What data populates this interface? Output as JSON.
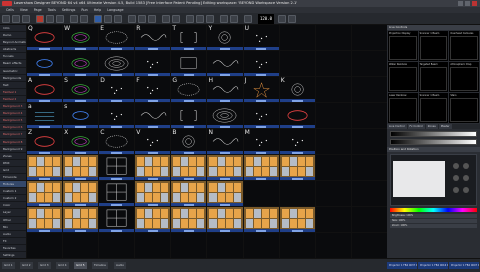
{
  "window": {
    "title": "Lasershow Designer BEYOND 64 v4 x64 Ultimate   Version 4.5, Build 1583   [Free Interface Patent Pending]   Editing workspace: 'BEYOND Workspace Version 2.1'"
  },
  "menu": [
    "Cells",
    "View",
    "Page",
    "Tools",
    "Settings",
    "Run",
    "Help",
    "Language"
  ],
  "toolbar": {
    "bpm_value": "120.0"
  },
  "left_panel": {
    "rows": [
      {
        "label": "Intro",
        "style": "normal"
      },
      {
        "label": "Demo",
        "style": "normal"
      },
      {
        "label": "Beyond Animations",
        "style": "normal"
      },
      {
        "label": "Abstracts",
        "style": "normal"
      },
      {
        "label": "Tunnels",
        "style": "normal"
      },
      {
        "label": "Beam effects",
        "style": "normal"
      },
      {
        "label": "Geometric",
        "style": "normal"
      },
      {
        "label": "Backgrounds",
        "style": "normal"
      },
      {
        "label": "Text",
        "style": "normal"
      },
      {
        "label": "Festival 1",
        "style": "red"
      },
      {
        "label": "Festival 2",
        "style": "red"
      },
      {
        "label": "Background 3",
        "style": "red"
      },
      {
        "label": "Background 4",
        "style": "red"
      },
      {
        "label": "Background 5",
        "style": "red"
      },
      {
        "label": "Background 6",
        "style": "red"
      },
      {
        "label": "Background 7",
        "style": "red"
      },
      {
        "label": "Background 8",
        "style": "red"
      },
      {
        "label": "Background 9",
        "style": "normal"
      },
      {
        "label": "Zones",
        "style": "normal"
      },
      {
        "label": "DMX",
        "style": "normal"
      },
      {
        "label": "Grid",
        "style": "normal"
      },
      {
        "label": "Timecode",
        "style": "normal"
      },
      {
        "label": "Fixtures",
        "style": "sel"
      },
      {
        "label": "Custom 1",
        "style": "normal"
      },
      {
        "label": "Custom 2",
        "style": "normal"
      },
      {
        "label": "Color",
        "style": "normal"
      },
      {
        "label": "Layer",
        "style": "normal"
      },
      {
        "label": "Other",
        "style": "normal"
      },
      {
        "label": "Mix",
        "style": "normal"
      },
      {
        "label": "Audio",
        "style": "normal"
      },
      {
        "label": "FX",
        "style": "normal"
      },
      {
        "label": "Favorites",
        "style": "normal"
      },
      {
        "label": "Settings",
        "style": "normal"
      }
    ]
  },
  "grid": {
    "cells": [
      {
        "key": "Q",
        "shape": "ellipse-red"
      },
      {
        "key": "W",
        "shape": "ellipse-multi"
      },
      {
        "key": "E",
        "shape": "dots-ring"
      },
      {
        "key": "R",
        "shape": "wave"
      },
      {
        "key": "T",
        "shape": "brackets"
      },
      {
        "key": "Y",
        "shape": "flower"
      },
      {
        "key": "U",
        "shape": "dots"
      },
      {
        "key": "",
        "shape": "none"
      },
      {
        "key": "",
        "shape": "none"
      },
      {
        "key": "",
        "shape": "none"
      },
      {
        "key": "",
        "shape": "ellipse-blue"
      },
      {
        "key": "",
        "shape": "ellipse-multi"
      },
      {
        "key": "",
        "shape": "rings"
      },
      {
        "key": "",
        "shape": "dots"
      },
      {
        "key": "",
        "shape": "rect"
      },
      {
        "key": "",
        "shape": "wave"
      },
      {
        "key": "",
        "shape": "dots"
      },
      {
        "key": "",
        "shape": "none"
      },
      {
        "key": "",
        "shape": "none"
      },
      {
        "key": "",
        "shape": "none"
      },
      {
        "key": "A",
        "shape": "ellipse-red"
      },
      {
        "key": "S",
        "shape": "ellipse-multi"
      },
      {
        "key": "D",
        "shape": "dots"
      },
      {
        "key": "F",
        "shape": "dots"
      },
      {
        "key": "G",
        "shape": "dots-ring"
      },
      {
        "key": "H",
        "shape": "wave"
      },
      {
        "key": "J",
        "shape": "star"
      },
      {
        "key": "K",
        "shape": "flower"
      },
      {
        "key": "",
        "shape": "none"
      },
      {
        "key": "",
        "shape": "none"
      },
      {
        "key": "a",
        "shape": "lines"
      },
      {
        "key": "s",
        "shape": "ellipse-blue"
      },
      {
        "key": "",
        "shape": "dots"
      },
      {
        "key": "",
        "shape": "wave"
      },
      {
        "key": "",
        "shape": "brackets"
      },
      {
        "key": "",
        "shape": "rings"
      },
      {
        "key": "",
        "shape": "dots"
      },
      {
        "key": "",
        "shape": "ellipse-red"
      },
      {
        "key": "",
        "shape": "none"
      },
      {
        "key": "",
        "shape": "none"
      },
      {
        "key": "Z",
        "shape": "ellipse-red"
      },
      {
        "key": "X",
        "shape": "ellipse-multi"
      },
      {
        "key": "C",
        "shape": "dots-ring"
      },
      {
        "key": "V",
        "shape": "dots"
      },
      {
        "key": "B",
        "shape": "flower"
      },
      {
        "key": "N",
        "shape": "wave"
      },
      {
        "key": "M",
        "shape": "dots"
      },
      {
        "key": "",
        "shape": "dots"
      },
      {
        "key": "",
        "shape": "none"
      },
      {
        "key": "",
        "shape": "none"
      },
      {
        "key": "",
        "shape": "orange"
      },
      {
        "key": "",
        "shape": "orange"
      },
      {
        "key": "",
        "shape": "grid"
      },
      {
        "key": "",
        "shape": "orange"
      },
      {
        "key": "",
        "shape": "orange"
      },
      {
        "key": "",
        "shape": "orange"
      },
      {
        "key": "",
        "shape": "orange"
      },
      {
        "key": "",
        "shape": "orange"
      },
      {
        "key": "",
        "shape": "none"
      },
      {
        "key": "",
        "shape": "none"
      },
      {
        "key": "",
        "shape": "orange"
      },
      {
        "key": "",
        "shape": "orange"
      },
      {
        "key": "",
        "shape": "grid"
      },
      {
        "key": "",
        "shape": "orange"
      },
      {
        "key": "",
        "shape": "orange"
      },
      {
        "key": "",
        "shape": "orange"
      },
      {
        "key": "",
        "shape": "none"
      },
      {
        "key": "",
        "shape": "none"
      },
      {
        "key": "",
        "shape": "none"
      },
      {
        "key": "",
        "shape": "none"
      },
      {
        "key": "",
        "shape": "orange"
      },
      {
        "key": "",
        "shape": "orange"
      },
      {
        "key": "",
        "shape": "grid"
      },
      {
        "key": "",
        "shape": "orange"
      },
      {
        "key": "",
        "shape": "orange"
      },
      {
        "key": "",
        "shape": "orange"
      },
      {
        "key": "",
        "shape": "orange"
      },
      {
        "key": "",
        "shape": "orange"
      },
      {
        "key": "",
        "shape": "none"
      },
      {
        "key": "",
        "shape": "none"
      },
      {
        "key": "",
        "shape": "none"
      },
      {
        "key": "",
        "shape": "none"
      },
      {
        "key": "",
        "shape": "none"
      },
      {
        "key": "",
        "shape": "none"
      },
      {
        "key": "",
        "shape": "none"
      },
      {
        "key": "",
        "shape": "none"
      },
      {
        "key": "",
        "shape": "none"
      },
      {
        "key": "",
        "shape": "none"
      },
      {
        "key": "",
        "shape": "none"
      },
      {
        "key": "",
        "shape": "none"
      }
    ]
  },
  "right_panel": {
    "header": "Live Controls",
    "thumbs": [
      "Projection Display",
      "Scanner 1 Beam",
      "Overhead Cameras",
      "Water Rainbow",
      "Targeted Beam",
      "Atmospheric Disp",
      "Laser Rainbow",
      "Scanner 1 Beam",
      "Stars"
    ],
    "tabs": [
      "Live Control",
      "Fx Control",
      "Zones",
      "Master"
    ],
    "section_position": "Position and Rotation",
    "labels": [
      "Brightness: 100%",
      "Size: 100%",
      "Zoom: 100%"
    ]
  },
  "status": {
    "tabs": [
      "Grid 1",
      "Grid 2",
      "Grid 3",
      "Grid 4",
      "Grid 5",
      "Timeline",
      "Audio"
    ],
    "active_tab": 4,
    "boxes": [
      "Projector 1 FB4 0037 Ring 1mc",
      "Projector 1 FB4 0016 Ring 2m",
      "Projector 1 FB4 0007 Ring 3m"
    ]
  }
}
